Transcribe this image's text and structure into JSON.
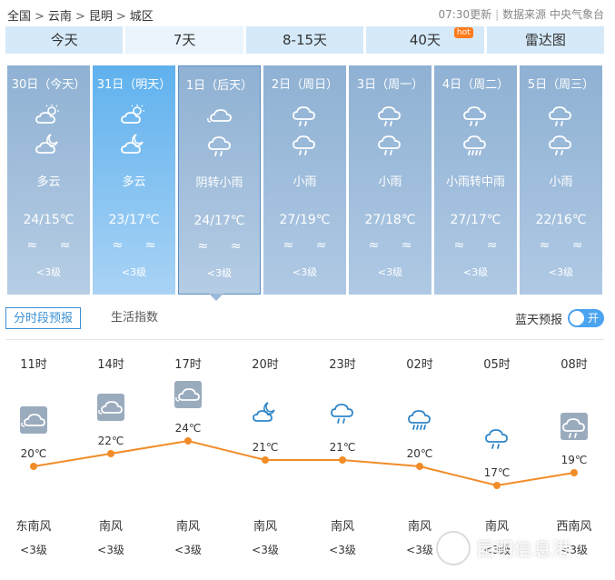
{
  "breadcrumb": {
    "items": [
      "全国",
      "云南",
      "昆明",
      "城区"
    ],
    "separator": ">"
  },
  "update": {
    "time_text": "07:30更新",
    "source_text": "数据来源 中央气象台",
    "divider": "|"
  },
  "tabs": [
    {
      "label": "今天"
    },
    {
      "label": "7天",
      "active": true
    },
    {
      "label": "8-15天"
    },
    {
      "label": "40天",
      "badge": "hot"
    },
    {
      "label": "雷达图"
    }
  ],
  "days": [
    {
      "date": "30日（今天）",
      "icons": [
        "partly-cloudy-day-icon",
        "partly-cloudy-night-icon"
      ],
      "weather": "多云",
      "temp": "24/15℃",
      "wind": "≈ ≈",
      "level": "<3级"
    },
    {
      "date": "31日（明天）",
      "icons": [
        "partly-cloudy-day-icon",
        "partly-cloudy-night-icon"
      ],
      "weather": "多云",
      "temp": "23/17℃",
      "wind": "≈ ≈",
      "level": "<3级"
    },
    {
      "date": "1日（后天）",
      "icons": [
        "overcast-icon",
        "light-rain-icon"
      ],
      "weather": "阴转小雨",
      "temp": "24/17℃",
      "wind": "≈ ≈",
      "level": "<3级"
    },
    {
      "date": "2日（周日）",
      "icons": [
        "light-rain-icon",
        "light-rain-icon"
      ],
      "weather": "小雨",
      "temp": "27/19℃",
      "wind": "≈ ≈",
      "level": "<3级"
    },
    {
      "date": "3日（周一）",
      "icons": [
        "light-rain-icon",
        "light-rain-icon"
      ],
      "weather": "小雨",
      "temp": "27/18℃",
      "wind": "≈ ≈",
      "level": "<3级"
    },
    {
      "date": "4日（周二）",
      "icons": [
        "light-rain-icon",
        "moderate-rain-icon"
      ],
      "weather": "小雨转中雨",
      "temp": "27/17℃",
      "wind": "≈ ≈",
      "level": "<3级"
    },
    {
      "date": "5日（周三）",
      "icons": [
        "light-rain-icon",
        "light-rain-icon"
      ],
      "weather": "小雨",
      "temp": "22/16℃",
      "wind": "≈ ≈",
      "level": "<3级"
    }
  ],
  "subnav": {
    "hourly_label": "分时段预报",
    "life_label": "生活指数",
    "toggle_label": "蓝天预报",
    "toggle_state": "开"
  },
  "hourly": [
    {
      "time": "11时",
      "icon": "overcast-icon",
      "temp": "20℃",
      "temp_value": 20,
      "wind_dir": "东南风",
      "wind_level": "<3级"
    },
    {
      "time": "14时",
      "icon": "overcast-icon",
      "temp": "22℃",
      "temp_value": 22,
      "wind_dir": "南风",
      "wind_level": "<3级"
    },
    {
      "time": "17时",
      "icon": "overcast-icon",
      "temp": "24℃",
      "temp_value": 24,
      "wind_dir": "南风",
      "wind_level": "<3级"
    },
    {
      "time": "20时",
      "icon": "partly-cloudy-night-icon",
      "temp": "21℃",
      "temp_value": 21,
      "wind_dir": "南风",
      "wind_level": "<3级"
    },
    {
      "time": "23时",
      "icon": "light-rain-icon",
      "temp": "21℃",
      "temp_value": 21,
      "wind_dir": "南风",
      "wind_level": "<3级"
    },
    {
      "time": "02时",
      "icon": "moderate-rain-icon",
      "temp": "20℃",
      "temp_value": 20,
      "wind_dir": "南风",
      "wind_level": "<3级"
    },
    {
      "time": "05时",
      "icon": "light-rain-icon",
      "temp": "17℃",
      "temp_value": 17,
      "wind_dir": "南风",
      "wind_level": "<3级"
    },
    {
      "time": "08时",
      "icon": "light-rain-icon",
      "temp": "19℃",
      "temp_value": 19,
      "wind_dir": "西南风",
      "wind_level": "<3级"
    }
  ],
  "watermark": {
    "text": "昆明信息港"
  },
  "colors": {
    "accent": "#3b8fd3",
    "curve": "#f28c28",
    "card": "#9bb9d9",
    "card_tomorrow": "#5fb1ee",
    "tab_bg": "#d5e9f9"
  }
}
